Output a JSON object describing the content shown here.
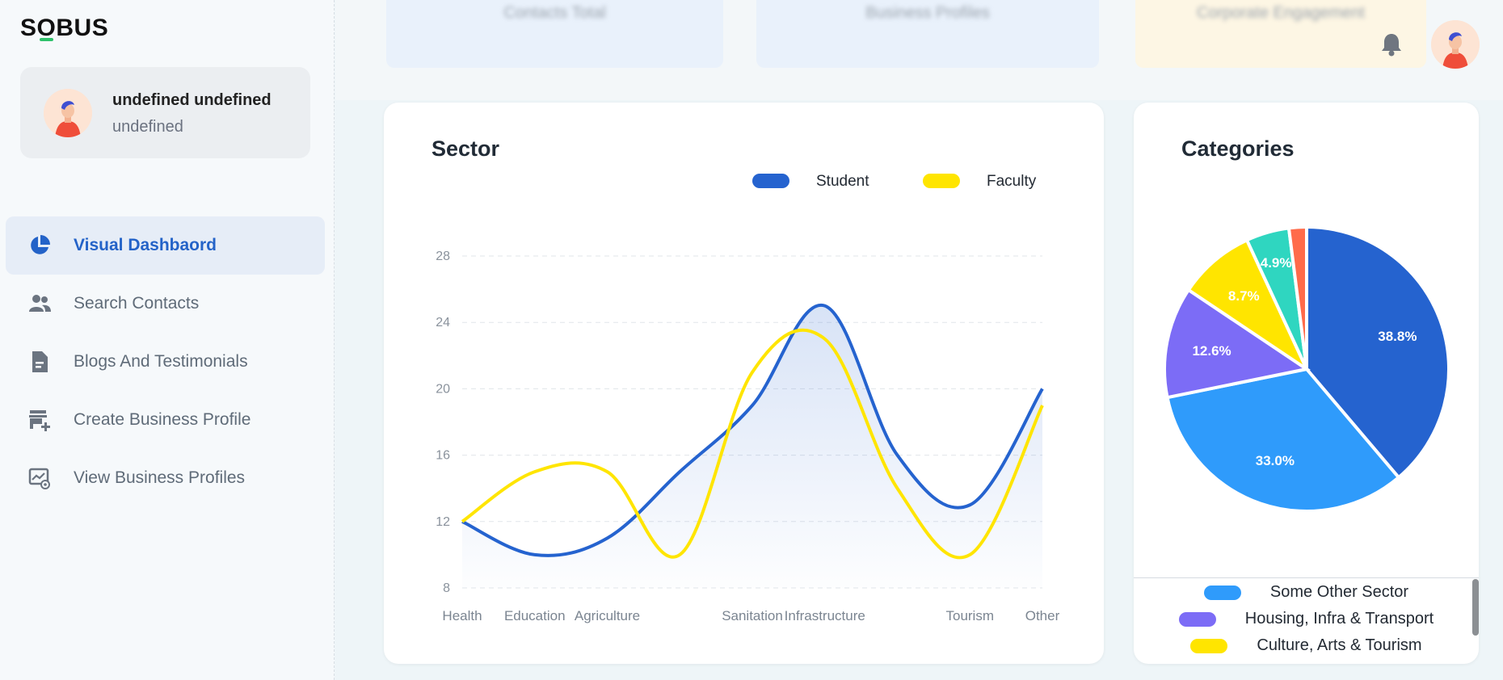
{
  "brand": {
    "logo_text_left": "S",
    "logo_text_o": "O",
    "logo_text_right": "BUS"
  },
  "profile": {
    "name": "undefined undefined",
    "role": "undefined"
  },
  "nav": {
    "items": [
      {
        "label": "Visual Dashbaord",
        "icon": "pie-chart-icon",
        "active": true
      },
      {
        "label": "Search Contacts",
        "icon": "users-icon"
      },
      {
        "label": "Blogs And Testimonials",
        "icon": "document-icon"
      },
      {
        "label": "Create Business Profile",
        "icon": "store-add-icon"
      },
      {
        "label": "View Business Profiles",
        "icon": "monitor-chart-icon"
      }
    ]
  },
  "top_cards": [
    {
      "label": "Contacts Total",
      "color": "#e9f1fb"
    },
    {
      "label": "Business Profiles",
      "color": "#e9f1fb"
    },
    {
      "label": "Corporate Engagement",
      "color": "#fdf6e4"
    }
  ],
  "header": {
    "bell_icon": "bell-icon",
    "avatar": "user-avatar"
  },
  "colors": {
    "accent": "#2463c8",
    "student": "#2563cf",
    "faculty": "#ffe500"
  },
  "sector": {
    "title": "Sector",
    "chart_data": {
      "type": "line",
      "title": "Sector",
      "categories": [
        "Health",
        "Education",
        "Agriculture",
        "",
        "Sanitation",
        "Infrastructure",
        "",
        "Tourism",
        "Other"
      ],
      "x_tick_labels": [
        "Health",
        "Education",
        "Agriculture",
        "Sanitation",
        "Infrastructure",
        "Tourism",
        "Other"
      ],
      "ylim": [
        8,
        28
      ],
      "yticks": [
        8,
        12,
        16,
        20,
        24,
        28
      ],
      "grid": true,
      "legend_position": "top-right",
      "series": [
        {
          "name": "Student",
          "color": "#2563cf",
          "values": [
            12,
            10,
            11,
            15,
            19,
            25,
            16,
            13,
            20
          ],
          "fill": true
        },
        {
          "name": "Faculty",
          "color": "#ffe500",
          "values": [
            12,
            15,
            15,
            10,
            21,
            23,
            14,
            10,
            19
          ],
          "fill": false
        }
      ]
    }
  },
  "categories": {
    "title": "Categories",
    "chart_data": {
      "type": "pie",
      "title": "Categories",
      "slices": [
        {
          "value": 38.8,
          "label": "38.8%",
          "color": "#2563cf"
        },
        {
          "value": 33.0,
          "label": "33.0%",
          "color": "#2f9bfb",
          "name": "Some Other Sector"
        },
        {
          "value": 12.6,
          "label": "12.6%",
          "color": "#7c6cf6",
          "name": "Housing, Infra & Transport"
        },
        {
          "value": 8.7,
          "label": "8.7%",
          "color": "#ffe500",
          "name": "Culture, Arts & Tourism"
        },
        {
          "value": 4.9,
          "label": "4.9%",
          "color": "#2fd6c0"
        },
        {
          "value": 2.0,
          "label": "",
          "color": "#ff6b4a"
        }
      ]
    },
    "legend": [
      {
        "label": "Some Other Sector",
        "color": "#2f9bfb"
      },
      {
        "label": "Housing, Infra & Transport",
        "color": "#7c6cf6"
      },
      {
        "label": "Culture, Arts & Tourism",
        "color": "#ffe500"
      }
    ]
  }
}
